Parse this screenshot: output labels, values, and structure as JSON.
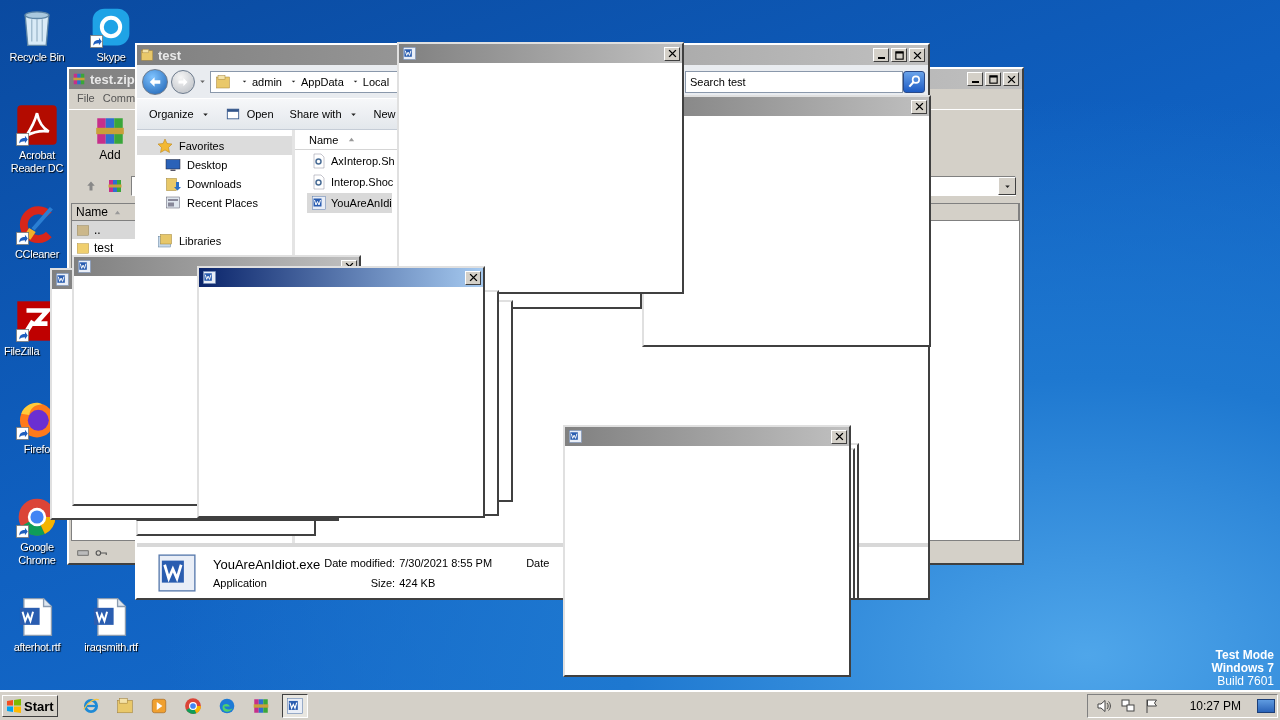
{
  "desktop_icons": [
    {
      "label": "Recycle Bin",
      "kind": "recycle",
      "shortcut": false
    },
    {
      "label": "Skype",
      "kind": "skype",
      "shortcut": true
    },
    {
      "label": "Acrobat Reader DC",
      "kind": "acrobat",
      "shortcut": true
    },
    {
      "label": "CCleaner",
      "kind": "ccleaner",
      "shortcut": true
    },
    {
      "label": "FileZilla",
      "kind": "filezilla",
      "shortcut": true
    },
    {
      "label": "Firefo",
      "kind": "firefox",
      "shortcut": true
    },
    {
      "label": "Google Chrome",
      "kind": "chrome",
      "shortcut": true
    },
    {
      "label": "afterhot.rtf",
      "kind": "document",
      "shortcut": false
    },
    {
      "label": "iraqsmith.rtf",
      "kind": "document",
      "shortcut": false
    }
  ],
  "winrar": {
    "title": "test.zip",
    "menu": [
      "File",
      "Comm"
    ],
    "toolbar": [
      "Add"
    ],
    "column": "Name",
    "rows": [
      {
        "name": "..",
        "kind": "up",
        "selected": true
      },
      {
        "name": "test",
        "kind": "folder",
        "selected": false
      }
    ]
  },
  "explorer": {
    "title": "test",
    "breadcrumbs": [
      "admin",
      "AppData",
      "Local"
    ],
    "search": {
      "placeholder": "Search test"
    },
    "toolbar": [
      {
        "label": "Organize",
        "kind": "menu"
      },
      {
        "label": "Open",
        "kind": "open"
      },
      {
        "label": "Share with",
        "kind": "menu"
      },
      {
        "label": "New",
        "kind": "plain"
      }
    ],
    "nav": [
      {
        "label": "Favorites",
        "kind": "star",
        "selected": true
      },
      {
        "label": "Desktop",
        "kind": "desktop",
        "selected": false
      },
      {
        "label": "Downloads",
        "kind": "downloads",
        "selected": false
      },
      {
        "label": "Recent Places",
        "kind": "recent",
        "selected": false
      },
      {
        "label": "Libraries",
        "kind": "libraries",
        "selected": false
      }
    ],
    "column": "Name",
    "files": [
      {
        "name": "AxInterop.Sh",
        "kind": "dll",
        "selected": false
      },
      {
        "name": "Interop.Shoc",
        "kind": "dll",
        "selected": false
      },
      {
        "name": "YouAreAnIdi",
        "kind": "exe",
        "selected": true
      }
    ],
    "details": {
      "name": "YouAreAnIdiot.exe",
      "type": "Application",
      "fields": [
        {
          "label": "Date modified:",
          "value": "7/30/2021 8:55 PM"
        },
        {
          "label": "Size:",
          "value": "424 KB"
        }
      ],
      "extra": "Date"
    }
  },
  "popups": [
    {
      "kind": "frame",
      "active": false
    },
    {
      "kind": "bare",
      "active": false
    },
    {
      "kind": "window",
      "active": false
    },
    {
      "kind": "frame",
      "active": false
    },
    {
      "kind": "frame",
      "active": false
    },
    {
      "kind": "stub",
      "active": false
    },
    {
      "kind": "window",
      "active": false
    },
    {
      "kind": "frame",
      "active": false
    },
    {
      "kind": "frame",
      "active": false
    },
    {
      "kind": "window",
      "active": true
    },
    {
      "kind": "frame",
      "active": false
    },
    {
      "kind": "frame",
      "active": false
    },
    {
      "kind": "window",
      "active": false
    }
  ],
  "taskbar": {
    "start": "Start",
    "apps": [
      {
        "kind": "ie",
        "selected": false
      },
      {
        "kind": "explorer",
        "selected": false
      },
      {
        "kind": "media",
        "selected": false
      },
      {
        "kind": "chrome",
        "selected": false
      },
      {
        "kind": "edge",
        "selected": false
      },
      {
        "kind": "winrar",
        "selected": false
      },
      {
        "kind": "word",
        "selected": true
      }
    ],
    "clock": "10:27 PM"
  },
  "os_notice": [
    "Test Mode",
    "Windows 7",
    "Build 7601"
  ]
}
